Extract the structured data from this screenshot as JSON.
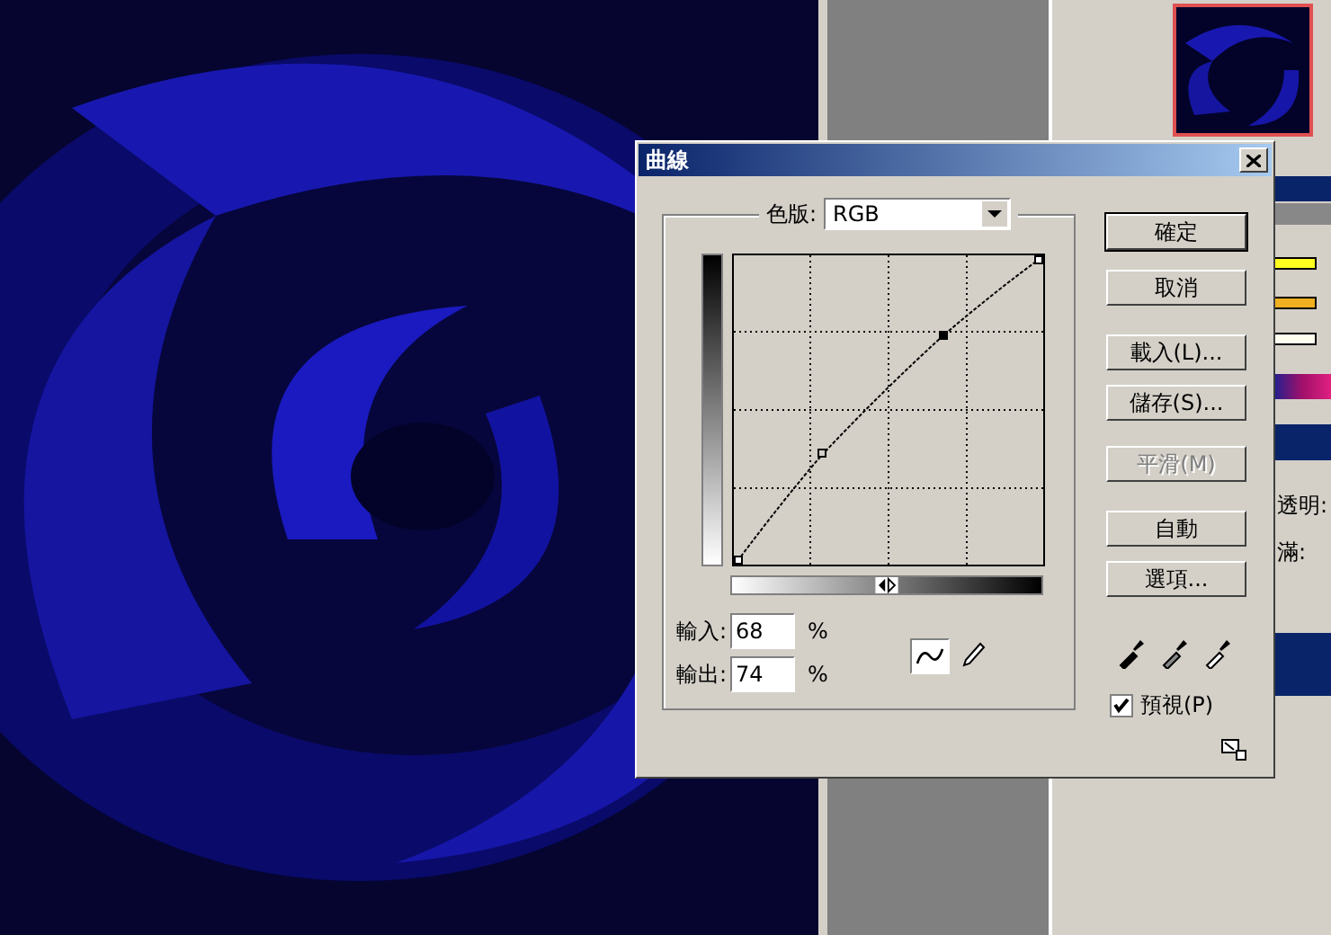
{
  "dialog": {
    "title": "曲線",
    "channel": {
      "label": "色版:",
      "value": "RGB"
    },
    "input": {
      "label": "輸入:",
      "value": "68",
      "unit": "%"
    },
    "output": {
      "label": "輸出:",
      "value": "74",
      "unit": "%"
    },
    "tools": [
      {
        "kind": "curve",
        "selected": true
      },
      {
        "kind": "pencil",
        "selected": false
      }
    ],
    "buttons": [
      {
        "label": "確定",
        "default": true,
        "disabled": false
      },
      {
        "label": "取消",
        "default": false,
        "disabled": false
      },
      {
        "label": "載入(L)...",
        "default": false,
        "disabled": false
      },
      {
        "label": "儲存(S)...",
        "default": false,
        "disabled": false
      },
      {
        "label": "平滑(M)",
        "default": false,
        "disabled": true
      },
      {
        "label": "自動",
        "default": false,
        "disabled": false
      },
      {
        "label": "選項...",
        "default": false,
        "disabled": false
      }
    ],
    "preview": {
      "label": "預視(P)",
      "checked": true
    }
  },
  "side_panel": {
    "labels": [
      "透明:",
      "滿:"
    ]
  }
}
